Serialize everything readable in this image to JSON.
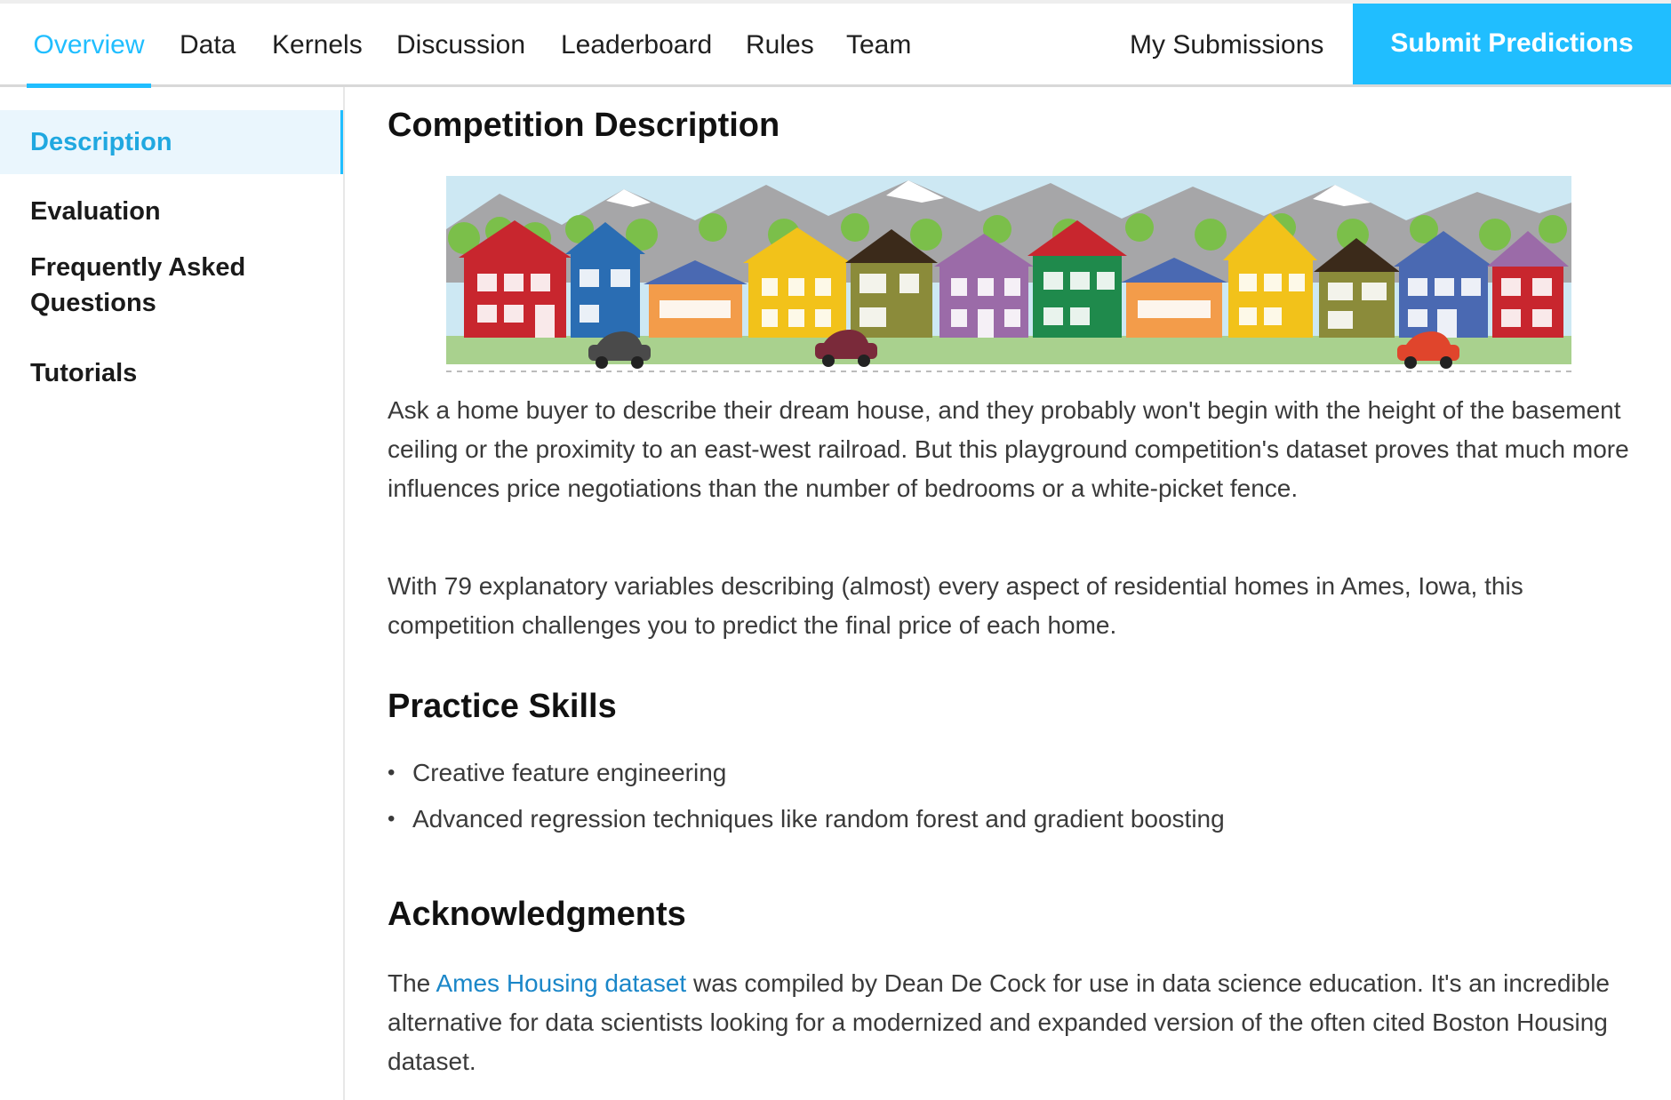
{
  "nav": {
    "tabs": [
      {
        "label": "Overview"
      },
      {
        "label": "Data"
      },
      {
        "label": "Kernels"
      },
      {
        "label": "Discussion"
      },
      {
        "label": "Leaderboard"
      },
      {
        "label": "Rules"
      },
      {
        "label": "Team"
      }
    ],
    "my_submissions": "My Submissions",
    "submit_button": "Submit Predictions"
  },
  "sidebar": {
    "items": [
      {
        "label": "Description"
      },
      {
        "label": "Evaluation"
      },
      {
        "label": "Frequently Asked"
      },
      {
        "label": "Questions"
      },
      {
        "label": "Tutorials"
      }
    ]
  },
  "content": {
    "title": "Competition Description",
    "paragraph1": "Ask a home buyer to describe their dream house, and they probably won't begin with the height of the basement ceiling or the proximity to an east-west railroad. But this playground competition's dataset proves that much more influences price negotiations than the number of bedrooms or a white-picket fence.",
    "paragraph2": "With 79 explanatory variables describing (almost) every aspect of residential homes in Ames, Iowa, this competition challenges you to predict the final price of each home.",
    "skills_title": "Practice Skills",
    "skills": [
      "Creative feature engineering",
      "Advanced regression techniques like random forest and gradient boosting"
    ],
    "ack_title": "Acknowledgments",
    "ack_prefix": "The ",
    "ack_link": "Ames Housing dataset",
    "ack_suffix": " was compiled by Dean De Cock for use in data science education. It's an incredible alternative for data scientists looking for a modernized and expanded version of the often cited Boston Housing dataset."
  },
  "colors": {
    "accent": "#20beff",
    "link": "#1a86c8",
    "sidebar_active_bg": "#eaf6fd"
  }
}
